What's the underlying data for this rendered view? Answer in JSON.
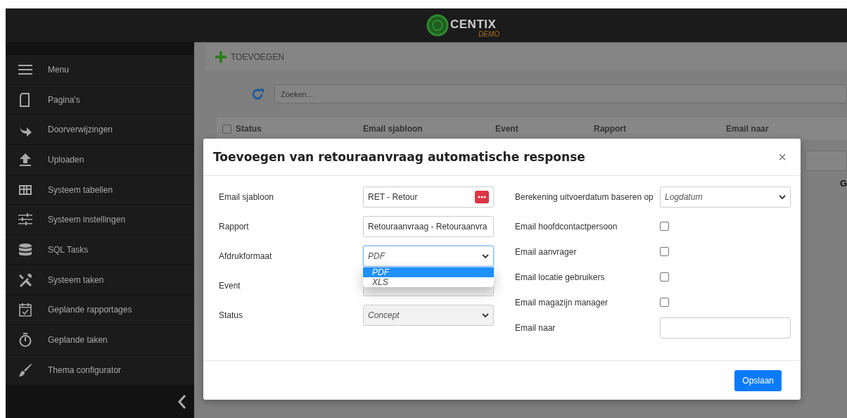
{
  "header": {
    "logo": {
      "name": "CENTIX",
      "tag": "DEMO"
    }
  },
  "sidebar": {
    "items": [
      {
        "label": "Menu"
      },
      {
        "label": "Pagina's"
      },
      {
        "label": "Doorverwijzingen"
      },
      {
        "label": "Uploaden"
      },
      {
        "label": "Systeem tabellen"
      },
      {
        "label": "Systeem instellingen"
      },
      {
        "label": "SQL Tasks"
      },
      {
        "label": "Systeem taken"
      },
      {
        "label": "Geplande rapportages"
      },
      {
        "label": "Geplande taken"
      },
      {
        "label": "Thema configurator"
      }
    ]
  },
  "toolbar": {
    "add_button": "TOEVOEGEN"
  },
  "search": {
    "placeholder": "Zoeken..."
  },
  "table": {
    "select_all_checked": false,
    "columns": [
      "Status",
      "Email sjabloon",
      "Event",
      "Rapport",
      "Email naar"
    ],
    "column_6": "G"
  },
  "dialog": {
    "title": "Toevoegen van retouraanvraag automatische response",
    "close": "×",
    "left_fields": [
      {
        "label": "Email sjabloon",
        "kind": "lookup",
        "value": "RET - Retour",
        "focused": false,
        "disabled": false
      },
      {
        "label": "Rapport",
        "kind": "text",
        "value": "Retouraanvraag - Retouraanvra",
        "focused": false,
        "disabled": false
      },
      {
        "label": "Afdrukformaat",
        "kind": "select",
        "value": "PDF",
        "focused": true,
        "disabled": false,
        "open": true,
        "options": [
          {
            "label": "PDF",
            "selected": true
          },
          {
            "label": "XLS",
            "selected": false
          }
        ]
      },
      {
        "label": "Event",
        "kind": "text",
        "focused": false,
        "disabled": true
      },
      {
        "label": "Status",
        "kind": "select",
        "value": "Concept",
        "focused": false,
        "disabled": true
      }
    ],
    "right_fields": [
      {
        "label": "Berekening uitvoerdatum baseren op",
        "kind": "select",
        "value": "Logdatum"
      },
      {
        "label": "Email hoofdcontactpersoon",
        "kind": "checkbox",
        "checked": false
      },
      {
        "label": "Email aanvrager",
        "kind": "checkbox",
        "checked": false
      },
      {
        "label": "Email locatie gebruikers",
        "kind": "checkbox",
        "checked": false
      },
      {
        "label": "Email magazijn manager",
        "kind": "checkbox",
        "checked": false
      },
      {
        "label": "Email naar",
        "kind": "text"
      }
    ],
    "save_button": "Opslaan"
  }
}
